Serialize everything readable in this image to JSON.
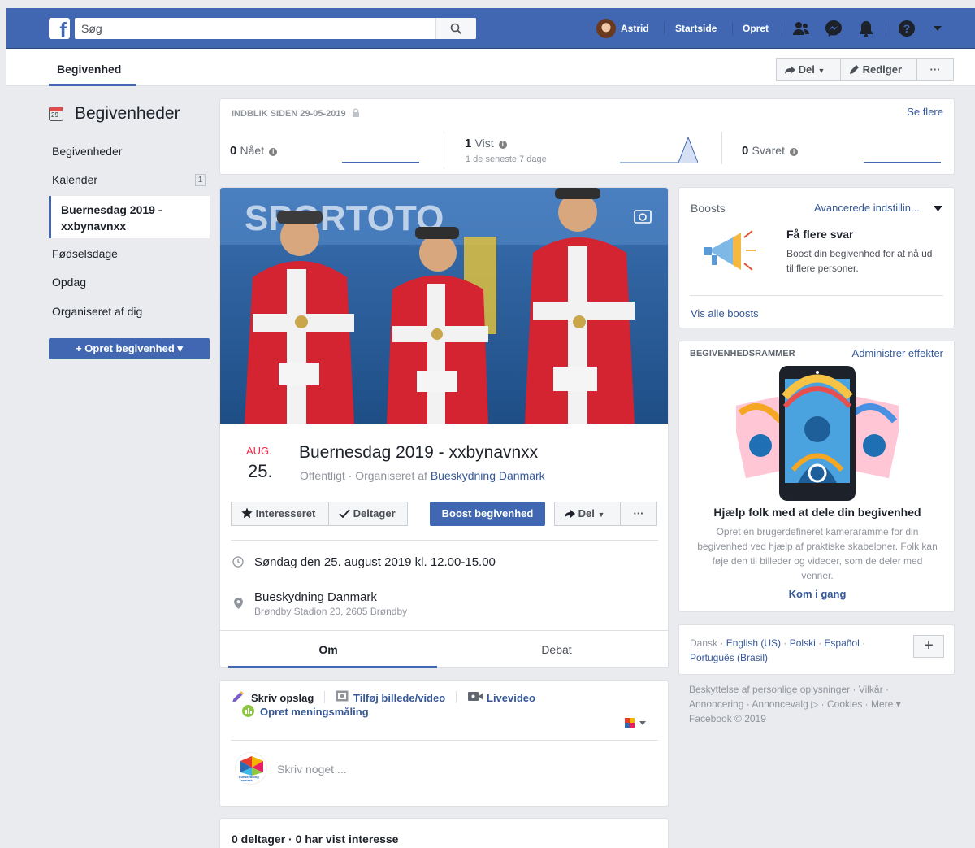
{
  "topbar": {
    "logo": "f",
    "search_placeholder": "Søg",
    "user_name": "Astrid",
    "home": "Startside",
    "create": "Opret",
    "icons": [
      "friends-icon",
      "messenger-icon",
      "notifications-icon",
      "help-icon",
      "account-menu-icon"
    ]
  },
  "subheader": {
    "tab": "Begivenhed",
    "share": "Del",
    "edit": "Rediger",
    "more": "···"
  },
  "sidebar": {
    "title": "Begivenheder",
    "calendar_icon_day": "29",
    "items": [
      {
        "label": "Begivenheder"
      },
      {
        "label": "Kalender",
        "badge": "1"
      },
      {
        "label": "Buernesdag 2019 - xxbynavnxx",
        "active": true
      },
      {
        "label": "Fødselsdage"
      },
      {
        "label": "Opdag"
      },
      {
        "label": "Organiseret af dig"
      }
    ],
    "create_button": "+ Opret begivenhed ▾"
  },
  "insights": {
    "title": "INDBLIK SIDEN 29-05-2019",
    "see_more": "Se flere",
    "reached": {
      "value": "0",
      "label": "Nået"
    },
    "viewed": {
      "value": "1",
      "label": "Vist",
      "sub": "1 de seneste 7 dage"
    },
    "responded": {
      "value": "0",
      "label": "Svaret"
    }
  },
  "event": {
    "month": "AUG.",
    "day": "25.",
    "title": "Buernesdag 2019 - xxbynavnxx",
    "meta_prefix": "Offentligt · Organiseret af ",
    "organizer": "Bueskydning Danmark",
    "buttons": {
      "interested": "Interesseret",
      "going": "Deltager",
      "boost": "Boost begivenhed",
      "share": "Del",
      "more": "···"
    },
    "when": "Søndag den 25. august 2019 kl. 12.00-15.00",
    "location_name": "Bueskydning Danmark",
    "location_address": "Brøndby Stadion 20, 2605 Brøndby",
    "tabs": {
      "about": "Om",
      "discussion": "Debat"
    }
  },
  "composer": {
    "write_post": "Skriv opslag",
    "add_photo": "Tilføj billede/video",
    "live": "Livevideo",
    "poll": "Opret meningsmåling",
    "placeholder": "Skriv noget ...",
    "avatar_text": "bueskydning danmark"
  },
  "participants": {
    "text": "0 deltager · 0 har vist interesse"
  },
  "boosts": {
    "title": "Boosts",
    "advanced": "Avancerede indstillin...",
    "heading": "Få flere svar",
    "description": "Boost din begivenhed for at nå ud til flere personer.",
    "see_all": "Vis alle boosts"
  },
  "frames": {
    "title": "BEGIVENHEDSRAMMER",
    "admin": "Administrer effekter",
    "heading": "Hjælp folk med at dele din begivenhed",
    "description": "Opret en brugerdefineret kameraramme for din begivenhed ved hjælp af praktiske skabeloner. Folk kan føje den til billeder og videoer, som de deler med venner.",
    "cta": "Kom i gang"
  },
  "languages": {
    "current": "Dansk",
    "others": [
      "English (US)",
      "Polski",
      "Español",
      "Português (Brasil)"
    ],
    "plus": "+"
  },
  "footer": {
    "line1": "Beskyttelse af personlige oplysninger · Vilkår ·",
    "line2": "Annoncering · Annoncevalg ▷ · Cookies · Mere ▾",
    "line3": "Facebook © 2019"
  },
  "cover_photo": {
    "banner_text": "SPORTOTO"
  },
  "colors": {
    "brand": "#4267b2",
    "link": "#365899",
    "date_red": "#f02849"
  }
}
